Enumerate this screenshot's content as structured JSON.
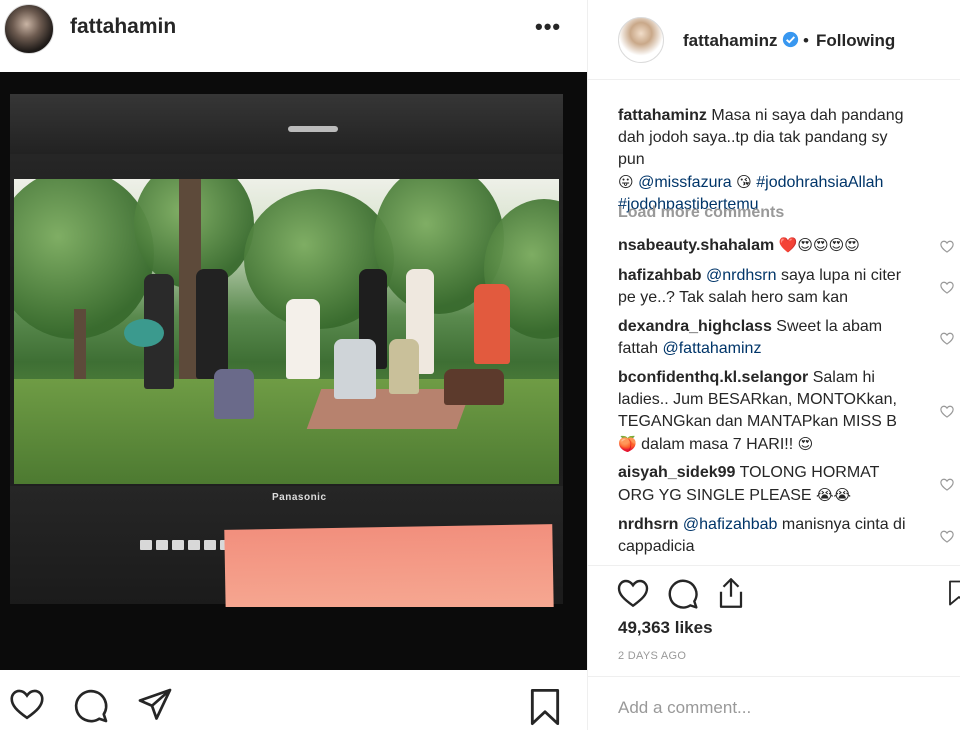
{
  "post_header": {
    "username": "fattahamin",
    "more_label": "•••"
  },
  "photo": {
    "monitor_brand": "Panasonic",
    "alt_subject": "outdoor film scene on studio monitor"
  },
  "side_header": {
    "username": "fattahaminz",
    "separator": "•",
    "follow_label": "Following"
  },
  "caption": {
    "username": "fattahaminz",
    "text": "Masa ni saya dah pandang dah jodoh saya..tp dia tak pandang sy pun",
    "emoji1": "😛",
    "mention": "@missfazura",
    "emoji2": "😘",
    "hashtag1": "#jodohrahsiaAllah",
    "hashtag2": "#jodohpastibertemu"
  },
  "load_more_label": "Load more comments",
  "comments": [
    {
      "username": "nsabeauty.shahalam",
      "text": "",
      "emoji": "❤️😍😍😍😍"
    },
    {
      "username": "hafizahbab",
      "mention": "@nrdhsrn",
      "text": "saya lupa ni citer pe ye..? Tak salah hero sam kan"
    },
    {
      "username": "dexandra_highclass",
      "text": "Sweet la abam fattah",
      "mention": "@fattahaminz"
    },
    {
      "username": "bconfidenthq.kl.selangor",
      "text": "Salam hi ladies.. Jum BESARkan, MONTOKkan, TEGANGkan dan MANTAPkan MISS B",
      "emoji": "🍑",
      "text2": "dalam masa 7 HARI!!",
      "emoji2": "😍"
    },
    {
      "username": "aisyah_sidek99",
      "text": "TOLONG HORMAT ORG YG SINGLE PLEASE",
      "emoji": "😭😭"
    },
    {
      "username": "nrdhsrn",
      "mention": "@hafizahbab",
      "text": "manisnya cinta di cappadicia"
    }
  ],
  "likes": "49,363 likes",
  "time_ago": "2 DAYS AGO",
  "add_comment_placeholder": "Add a comment...",
  "colors": {
    "text": "#262626",
    "muted": "#999999",
    "link": "#003569",
    "verified": "#3897f0",
    "border": "#efefef"
  },
  "icons": [
    "heart-icon",
    "comment-icon",
    "share-icon",
    "bookmark-icon",
    "more-icon",
    "verified-icon"
  ]
}
